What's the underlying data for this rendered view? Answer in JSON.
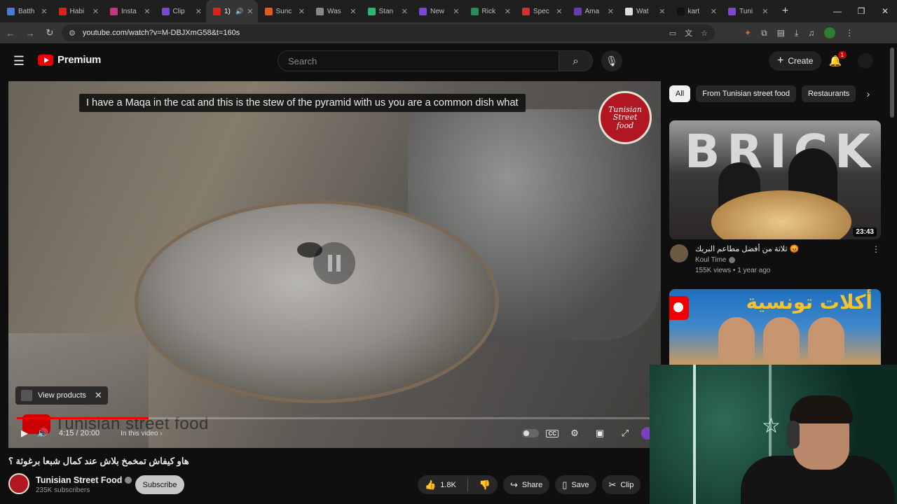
{
  "browser": {
    "tabs": [
      {
        "label": "Batth",
        "favicon_color": "#4a7bd6"
      },
      {
        "label": "Habi",
        "favicon_color": "#e02020"
      },
      {
        "label": "Insta",
        "favicon_color": "#c13584"
      },
      {
        "label": "Clip",
        "favicon_color": "#7b46d1"
      },
      {
        "label": "1)",
        "favicon_color": "#e02020",
        "active": true
      },
      {
        "label": "Sunc",
        "favicon_color": "#e55a1e"
      },
      {
        "label": "Was",
        "favicon_color": "#888888"
      },
      {
        "label": "Stan",
        "favicon_color": "#2bb673"
      },
      {
        "label": "New",
        "favicon_color": "#7b46d1"
      },
      {
        "label": "Rick",
        "favicon_color": "#2e8b57"
      },
      {
        "label": "Spec",
        "favicon_color": "#d32f2f"
      },
      {
        "label": "Ama",
        "favicon_color": "#6a3ab2"
      },
      {
        "label": "Wat",
        "favicon_color": "#dddddd"
      },
      {
        "label": "kart",
        "favicon_color": "#111111"
      },
      {
        "label": "Tuni",
        "favicon_color": "#7b46d1"
      }
    ],
    "url": "youtube.com/watch?v=M-DBJXmG58&t=160s",
    "new_tab_glyph": "+"
  },
  "youtube": {
    "logo_text": "Premium",
    "search_placeholder": "Search",
    "create_label": "Create",
    "notification_count": "1",
    "caption": "I have a Maqa in the cat and this is the stew of the pyramid with us you are a common dish what",
    "watermark_line1": "Tunisian",
    "watermark_line2": "Street",
    "watermark_line3": "food",
    "view_products_label": "View products",
    "overlay_brand_text": "Tunisian street food",
    "progress_fraction": 0.2075,
    "time_display": "4:15 / 20:00",
    "in_this_video_label": "In this video",
    "video_title": "هاو كيفاش تمخمخ بلاش عند كمال شبعا برغوثة ؟",
    "channel_name": "Tunisian Street Food",
    "subscribers": "235K subscribers",
    "subscribe_label": "Subscribe",
    "like_count": "1.8K",
    "share_label": "Share",
    "save_label": "Save",
    "clip_label": "Clip",
    "chips": [
      "All",
      "From Tunisian street food",
      "Restaurants"
    ],
    "recommendations": [
      {
        "thumb_text": "BRICK",
        "duration": "23:43",
        "title": "😡 ثلاثة من أفضل مطاعم البريك",
        "channel": "Koul Time",
        "meta": "155K views • 1 year ago"
      },
      {
        "thumb_text": "أكلات تونسية"
      }
    ]
  }
}
